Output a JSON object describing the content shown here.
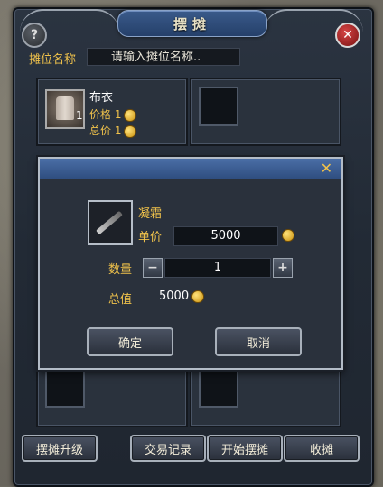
{
  "window": {
    "title": "摆摊"
  },
  "stall": {
    "name_label": "摊位名称",
    "name_placeholder": "请输入摊位名称.."
  },
  "slots": [
    {
      "item_name": "布衣",
      "count": "1",
      "price_label": "价格",
      "price_value": "1",
      "total_label": "总价",
      "total_value": "1"
    }
  ],
  "bottom_buttons": {
    "upgrade": "摆摊升级",
    "trade_log": "交易记录",
    "start": "开始摆摊",
    "close_stall": "收摊"
  },
  "dialog": {
    "item_name": "凝霜",
    "unit_price_label": "单价",
    "unit_price_value": "5000",
    "quantity_label": "数量",
    "quantity_value": "1",
    "total_label": "总值",
    "total_value": "5000",
    "confirm": "确定",
    "cancel": "取消"
  },
  "icons": {
    "help": "help-icon",
    "close": "close-icon",
    "coin": "gold-coin-icon",
    "minus": "minus-icon",
    "plus": "plus-icon"
  },
  "colors": {
    "accent_gold": "#f0c24b",
    "title_blue": "#2f4e80",
    "close_red": "#b52020"
  }
}
